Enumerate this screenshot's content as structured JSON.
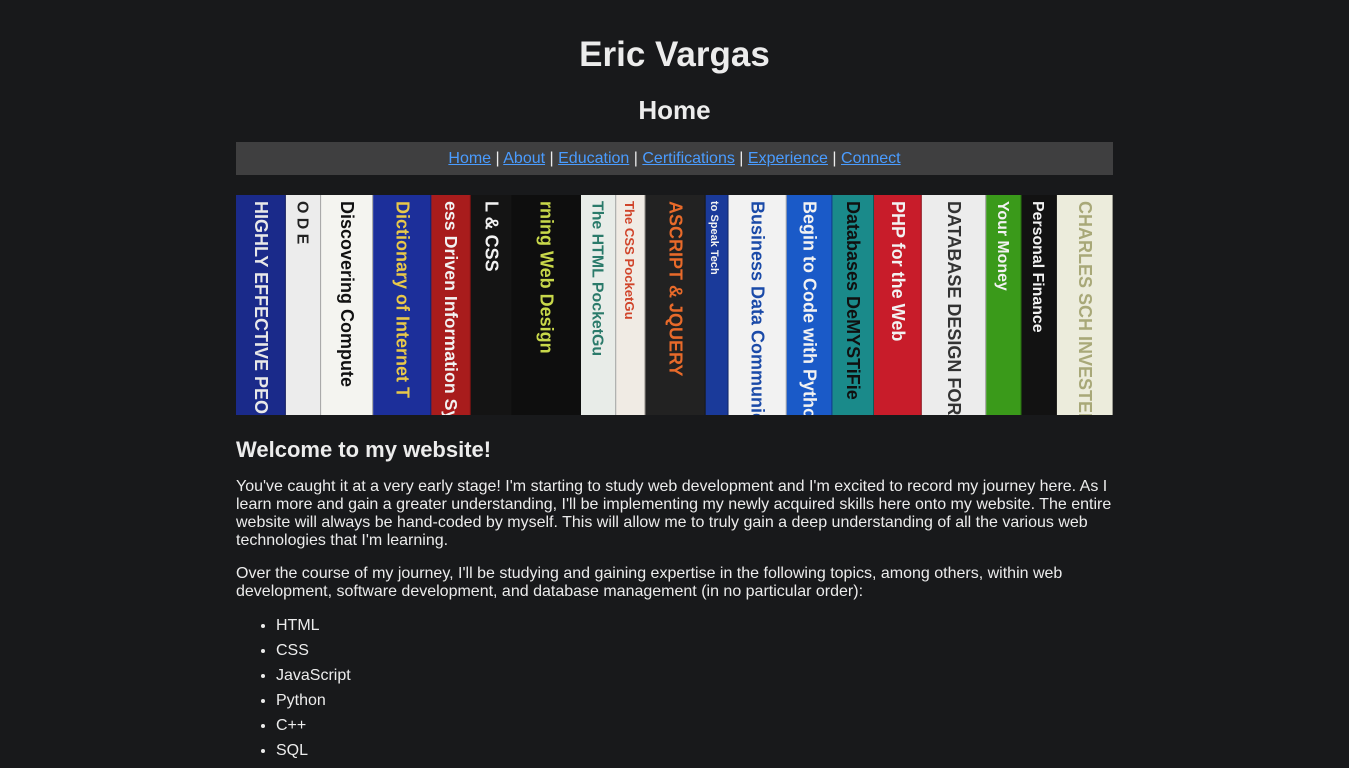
{
  "header": {
    "site_title": "Eric Vargas",
    "page_heading": "Home"
  },
  "nav": {
    "items": [
      "Home",
      "About",
      "Education",
      "Certifications",
      "Experience",
      "Connect"
    ],
    "separator": "|"
  },
  "banner": {
    "spines": [
      {
        "text": "HIGHLY EFFECTIVE PEO",
        "bg": "#1a2a8a",
        "fg": "#e8e8e8"
      },
      {
        "text": "O D E",
        "bg": "#ececec",
        "fg": "#222222"
      },
      {
        "text": "Discovering Compute",
        "bg": "#f4f4f0",
        "fg": "#111111"
      },
      {
        "text": "Dictionary of Internet T",
        "bg": "#1c2f9a",
        "fg": "#e8c84a"
      },
      {
        "text": "ess Driven Information Syst",
        "bg": "#a81c1c",
        "fg": "#f2f2f2"
      },
      {
        "text": "L & CSS",
        "bg": "#141414",
        "fg": "#f2f2f2"
      },
      {
        "text": "rning Web Design",
        "bg": "#0e0e0e",
        "fg": "#c8d84a"
      },
      {
        "text": "The HTML PocketGu",
        "bg": "#e8ece8",
        "fg": "#2a7a6a"
      },
      {
        "text": "The CSS PocketGu",
        "bg": "#f0ebe4",
        "fg": "#d0442a"
      },
      {
        "text": "ASCRIPT & JQUERY",
        "bg": "#222222",
        "fg": "#e86a2a"
      },
      {
        "text": "to Speak Tech",
        "bg": "#1a3a9a",
        "fg": "#f2f2f2"
      },
      {
        "text": "Business Data Communications & IT Inf",
        "bg": "#f2f2f2",
        "fg": "#1a4aa8"
      },
      {
        "text": "Begin to Code with Pytho",
        "bg": "#1a5ac8",
        "fg": "#f2f2f2"
      },
      {
        "text": "Databases DeMYSTiFie",
        "bg": "#1a8a8a",
        "fg": "#101010"
      },
      {
        "text": "PHP for the Web",
        "bg": "#c81c2a",
        "fg": "#f2f2f2"
      },
      {
        "text": "DATABASE DESIGN FOR MERE MORTALS",
        "bg": "#ececec",
        "fg": "#333333"
      },
      {
        "text": "Your Money",
        "bg": "#3a9a1a",
        "fg": "#f2f2f2"
      },
      {
        "text": "Personal Finance",
        "bg": "#121212",
        "fg": "#f2f2f2"
      },
      {
        "text": "CHARLES SCH INVESTED",
        "bg": "#ececdc",
        "fg": "#a8a878"
      }
    ]
  },
  "content": {
    "welcome": "Welcome to my website!",
    "intro": "You've caught it at a very early stage! I'm starting to study web development and I'm excited to record my journey here. As I learn more and gain a greater understanding, I'll be implementing my newly acquired skills here onto my website. The entire website will always be hand-coded by myself. This will allow me to truly gain a deep understanding of all the various web technologies that I'm learning.",
    "topics_intro": "Over the course of my journey, I'll be studying and gaining expertise in the following topics, among others, within web development, software development, and database management (in no particular order):",
    "topics": [
      "HTML",
      "CSS",
      "JavaScript",
      "Python",
      "C++",
      "SQL"
    ]
  }
}
